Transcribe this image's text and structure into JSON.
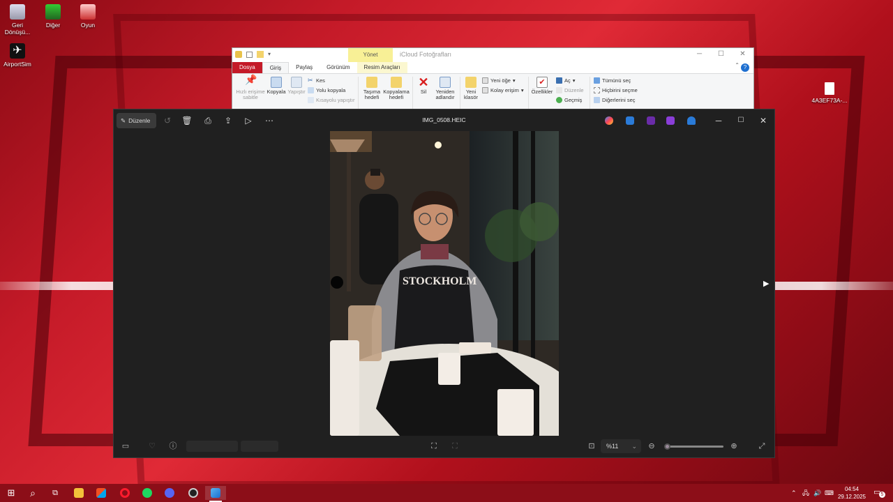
{
  "desktop": {
    "icons": [
      {
        "label": "Geri Dönüşü...",
        "icon": "recycle-bin-icon"
      },
      {
        "label": "Diğer",
        "icon": "folder-app-icon"
      },
      {
        "label": "Oyun",
        "icon": "game-icon"
      },
      {
        "label": "AirportSim",
        "icon": "airplane-icon"
      },
      {
        "label": "4A3EF73A-...",
        "icon": "file-icon"
      }
    ]
  },
  "explorer": {
    "context_tab": "Yönet",
    "title": "iCloud Fotoğrafları",
    "tabs": [
      "Dosya",
      "Giriş",
      "Paylaş",
      "Görünüm",
      "Resim Araçları"
    ],
    "active_tab": "Giriş",
    "ribbon": {
      "pin": "Hızlı erişime sabitle",
      "copy": "Kopyala",
      "paste": "Yapıştır",
      "cut": "Kes",
      "copy_path": "Yolu kopyala",
      "paste_shortcut": "Kısayolu yapıştır",
      "move_to": "Taşıma hedefi",
      "copy_to": "Kopyalama hedefi",
      "delete": "Sil",
      "rename": "Yeniden adlandır",
      "new_folder": "Yeni klasör",
      "new_item": "Yeni öğe",
      "easy_access": "Kolay erişim",
      "properties": "Özellikler",
      "open": "Aç",
      "edit": "Düzenle",
      "history": "Geçmiş",
      "select_all": "Tümünü seç",
      "select_none": "Hiçbirini seçme",
      "invert": "Diğerlerini seç"
    }
  },
  "photos": {
    "edit_label": "Düzenle",
    "filename": "IMG_0508.HEIC",
    "zoom": "%11",
    "zoom_level": 0.11
  },
  "taskbar": {
    "time": "04:54",
    "date": "29.12.2025",
    "notifications": "5"
  },
  "colors": {
    "accent": "#c41a28",
    "photos_bg": "#202020",
    "taskbar": "#8c0e18"
  }
}
